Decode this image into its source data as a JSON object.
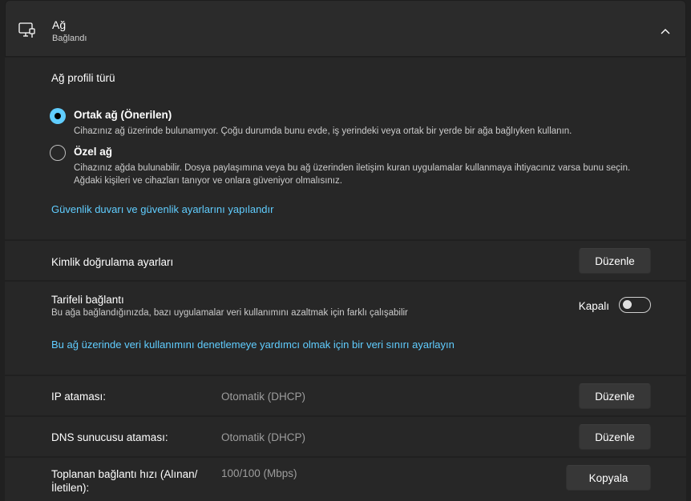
{
  "header": {
    "title": "Ağ",
    "subtitle": "Bağlandı",
    "icon": "network-monitor-icon",
    "chevron": "chevron-up-icon"
  },
  "profile": {
    "title": "Ağ profili türü",
    "options": [
      {
        "label": "Ortak ağ (Önerilen)",
        "description": "Cihazınız ağ üzerinde bulunamıyor. Çoğu durumda bunu evde, iş yerindeki veya ortak bir yerde bir ağa bağlıyken kullanın.",
        "selected": true
      },
      {
        "label": "Özel ağ",
        "description": "Cihazınız ağda bulunabilir. Dosya paylaşımına veya bu ağ üzerinden iletişim kuran uygulamalar kullanmaya ihtiyacınız varsa bunu seçin. Ağdaki kişileri ve cihazları tanıyor ve onlara güveniyor olmalısınız.",
        "selected": false
      }
    ],
    "firewall_link": "Güvenlik duvarı ve güvenlik ayarlarını yapılandır"
  },
  "auth": {
    "label": "Kimlik doğrulama ayarları",
    "button": "Düzenle"
  },
  "metered": {
    "label": "Tarifeli bağlantı",
    "description": "Bu ağa bağlandığınızda, bazı uygulamalar veri kullanımını azaltmak için farklı çalışabilir",
    "toggle_label": "Kapalı",
    "toggle_on": false,
    "data_limit_link": "Bu ağ üzerinde veri kullanımını denetlemeye yardımcı olmak için bir veri sınırı ayarlayın"
  },
  "ip": {
    "label": "IP ataması:",
    "value": "Otomatik (DHCP)",
    "button": "Düzenle"
  },
  "dns": {
    "label": "DNS sunucusu ataması:",
    "value": "Otomatik (DHCP)",
    "button": "Düzenle"
  },
  "speed": {
    "label": "Toplanan bağlantı hızı (Alınan/ İletilen):",
    "value": "100/100 (Mbps)",
    "button": "Kopyala"
  },
  "colors": {
    "accent": "#60cdff",
    "background": "#202020",
    "card": "#2b2b2b"
  }
}
